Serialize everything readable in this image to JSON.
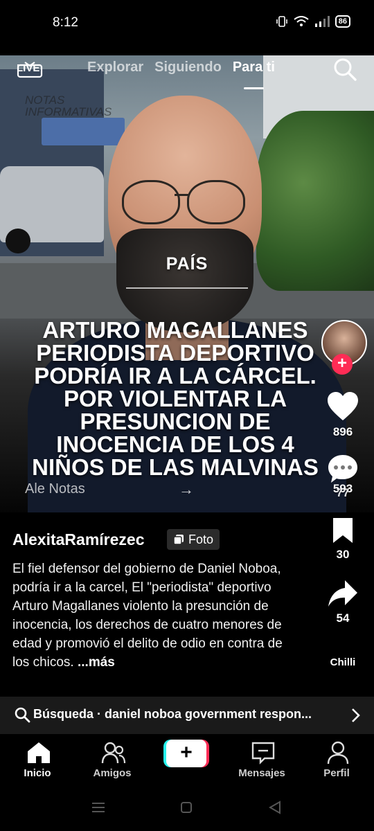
{
  "status_bar": {
    "time": "8:12",
    "battery": "86"
  },
  "top_nav": {
    "live_label": "LIVE",
    "tabs": [
      {
        "label": "Explorar"
      },
      {
        "label": "Siguiendo"
      },
      {
        "label": "Para ti",
        "active": true
      }
    ]
  },
  "video": {
    "watermark_line1": "NOTAS",
    "watermark_line2": "INFORMATIVAS",
    "category": "PAÍS",
    "headline": "ARTURO MAGALLANES PERIODISTA DEPORTIVO PODRÍA IR A LA CÁRCEL. POR VIOLENTAR LA PRESUNCION DE INOCENCIA DE LOS 4 NIÑOS DE LAS MALVINAS",
    "music_label": "Ale Notas",
    "music_arrow": "→"
  },
  "rail": {
    "likes": "896",
    "comments": "593",
    "comments_overlay": "77",
    "saves": "30",
    "shares": "54",
    "chilli": "Chilli"
  },
  "post": {
    "username": "AlexitaRamírezec",
    "badge": "Foto",
    "caption": "El fiel defensor del gobierno de Daniel Noboa, podría ir a la carcel, El \"periodista\" deportivo Arturo Magallanes violento la presunción de inocencia, los derechos de cuatro menores de edad y promovió el delito de odio en contra de los chicos.",
    "more": " ...más"
  },
  "search": {
    "text": "Búsqueda · daniel noboa government respon..."
  },
  "bottom_nav": {
    "home": "Inicio",
    "friends": "Amigos",
    "create": "+",
    "inbox": "Mensajes",
    "profile": "Perfil"
  },
  "colors": {
    "accent": "#fe2c55",
    "cyan": "#25f4ee",
    "background": "#000000"
  }
}
